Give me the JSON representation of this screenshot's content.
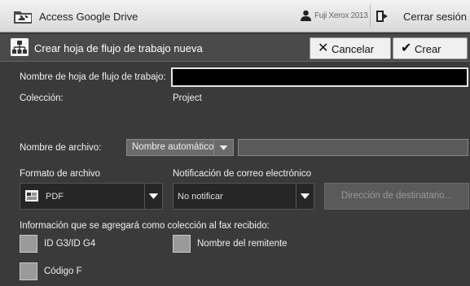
{
  "topbar": {
    "app_title": "Access Google Drive",
    "user_name": "Fuji Xerox 2013",
    "logout_label": "Cerrar sesión"
  },
  "actionbar": {
    "title": "Crear hoja de flujo de trabajo nueva",
    "cancel_label": "Cancelar",
    "create_label": "Crear"
  },
  "form": {
    "sheet_name_label": "Nombre de hoja de flujo de trabajo:",
    "sheet_name_value": "",
    "collection_label": "Colección:",
    "collection_value": "Project",
    "filename_label": "Nombre de archivo:",
    "filename_mode": "Nombre automático",
    "filename_value": "",
    "format_label": "Formato de archivo",
    "format_value": "PDF",
    "notify_label": "Notificación de correo electrónico",
    "notify_value": "No notificar",
    "recipient_label": "Dirección de destinatario...",
    "fax_info_label": "Información que se agregará como colección al fax recibido:",
    "checkboxes": [
      {
        "label": "ID G3/ID G4",
        "checked": false
      },
      {
        "label": "Nombre del remitente",
        "checked": false
      },
      {
        "label": "Código F",
        "checked": false
      }
    ]
  },
  "icons": {
    "drive": "google-drive-folder-icon",
    "user": "user-icon",
    "logout": "logout-icon",
    "workflow": "workflow-icon",
    "cancel": "x-icon",
    "create": "check-icon",
    "pdf": "pdf-document-icon",
    "dropdown": "chevron-down-icon"
  },
  "colors": {
    "content_bg": "#3a3a3a",
    "input_bg": "#000000",
    "disabled_text": "#9a9a9a"
  }
}
